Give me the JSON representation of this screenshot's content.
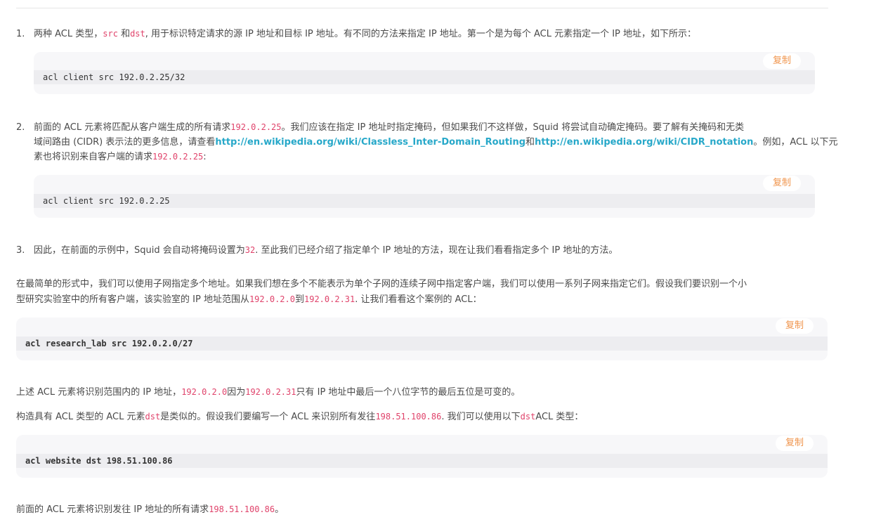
{
  "copy_label": "复制",
  "items": [
    {
      "num": "1.",
      "text_a": "两种 ACL 类型，",
      "code_a": "src",
      "text_b": " 和",
      "code_b": "dst",
      "text_c": ", 用于标识特定请求的源 IP 地址和目标 IP 地址。有不同的方法来指定 IP 地址。第一个是为每个 ACL 元素指定一个 IP 地址，如下所示："
    },
    {
      "num": "2.",
      "line1_a": "前面的 ACL 元素将匹配从客户端生成的所有请求",
      "line1_code": "192.0.2.25",
      "line1_b": "。我们应该在指定 IP 地址时指定掩码，但如果我们不这样做，Squid 将尝试自动确定掩码。要了解有关掩码和无类",
      "line2_a": "域间路由 (CIDR) 表示法的更多信息，请查看",
      "link1": "http://en.wikipedia.org/wiki/Classless_Inter-Domain_Routing",
      "line2_b": "和",
      "link2": "http://en.wikipedia.org/wiki/CIDR_notation",
      "line2_c": "。例如，ACL 以下元",
      "line3_a": "素也将识别来自客户端的请求",
      "line3_code": "192.0.2.25",
      "line3_b": ":"
    },
    {
      "num": "3.",
      "text_a": "因此，在前面的示例中，Squid 会自动将掩码设置为",
      "code_a": "32",
      "text_b": ". 至此我们已经介绍了指定单个 IP 地址的方法，现在让我们看看指定多个 IP 地址的方法。"
    }
  ],
  "para1": {
    "line1": "在最简单的形式中，我们可以使用子网指定多个地址。如果我们想在多个不能表示为单个子网的连续子网中指定客户端，我们可以使用一系列子网来指定它们。假设我们要识别一个小",
    "line2_a": "型研究实验室中的所有客户端，该实验室的 IP 地址范围从",
    "code_a": "192.0.2.0",
    "line2_b": "到",
    "code_b": "192.0.2.31",
    "line2_c": ". 让我们看看这个案例的 ACL："
  },
  "para2": {
    "text_a": "上述 ACL 元素将识别范围内的 IP 地址，",
    "code_a": "192.0.2.0",
    "text_b": "因为",
    "code_b": "192.0.2.31",
    "text_c": "只有 IP 地址中最后一个八位字节的最后五位是可变的。"
  },
  "para3": {
    "text_a": "构造具有 ACL 类型的 ACL 元素",
    "code_a": "dst",
    "text_b": "是类似的。假设我们要编写一个 ACL 来识别所有发往",
    "code_b": "198.51.100.86",
    "text_c": ". 我们可以使用以下",
    "code_c": "dst",
    "text_d": "ACL 类型："
  },
  "para4": {
    "text_a": "前面的 ACL 元素将识别发往 IP 地址的所有请求",
    "code_a": "198.51.100.86",
    "text_b": "。"
  },
  "code_blocks": [
    "acl client src 192.0.2.25/32",
    "acl client src 192.0.2.25",
    "acl research_lab src 192.0.2.0/27",
    "acl website dst 198.51.100.86"
  ]
}
